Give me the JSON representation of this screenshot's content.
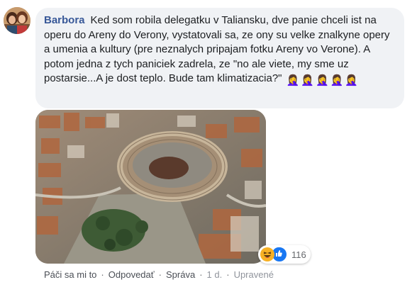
{
  "comment": {
    "author": "Barbora",
    "text": "Ked som robila delegatku v Taliansku, dve panie chceli ist na operu do Areny do Verony, vystatovali sa, ze ony su velke znalkyne opery a umenia a kultury (pre neznalych pripajam fotku Areny vo Verone). A potom jedna z tych paniciek zadrela, ze \"no ale viete, my sme uz postarsie...A je dost teplo. Bude tam klimatizacia?\"",
    "emojis": [
      "🤦‍♀️",
      "🤦‍♀️",
      "🤦‍♀️",
      "🤦‍♀️",
      "🤦‍♀️"
    ],
    "reactions": {
      "icons": [
        "haha-icon",
        "like-icon"
      ],
      "count": "116"
    }
  },
  "actions": {
    "like": "Páči sa mi to",
    "reply": "Odpovedať",
    "message": "Správa",
    "time": "1 d.",
    "edited": "Upravené"
  },
  "colors": {
    "author": "#385898",
    "bubble": "#f0f2f5",
    "like_blue": "#1877f2",
    "haha_yellow": "#f7b125"
  }
}
